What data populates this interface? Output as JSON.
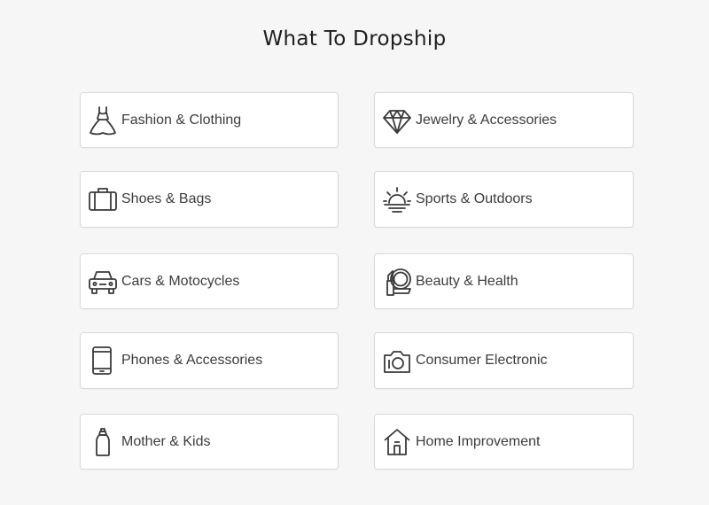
{
  "page": {
    "title": "What To Dropship"
  },
  "categories": [
    {
      "label": "Fashion & Clothing",
      "icon": "dress-icon"
    },
    {
      "label": "Jewelry & Accessories",
      "icon": "diamond-icon"
    },
    {
      "label": "Shoes & Bags",
      "icon": "suitcase-icon"
    },
    {
      "label": "Sports & Outdoors",
      "icon": "sunrise-icon"
    },
    {
      "label": "Cars & Motocycles",
      "icon": "car-icon"
    },
    {
      "label": "Beauty & Health",
      "icon": "mirror-lipstick-icon"
    },
    {
      "label": "Phones & Accessories",
      "icon": "phone-icon"
    },
    {
      "label": "Consumer Electronic",
      "icon": "camera-icon"
    },
    {
      "label": "Mother & Kids",
      "icon": "baby-bottle-icon"
    },
    {
      "label": "Home Improvement",
      "icon": "house-icon"
    }
  ]
}
